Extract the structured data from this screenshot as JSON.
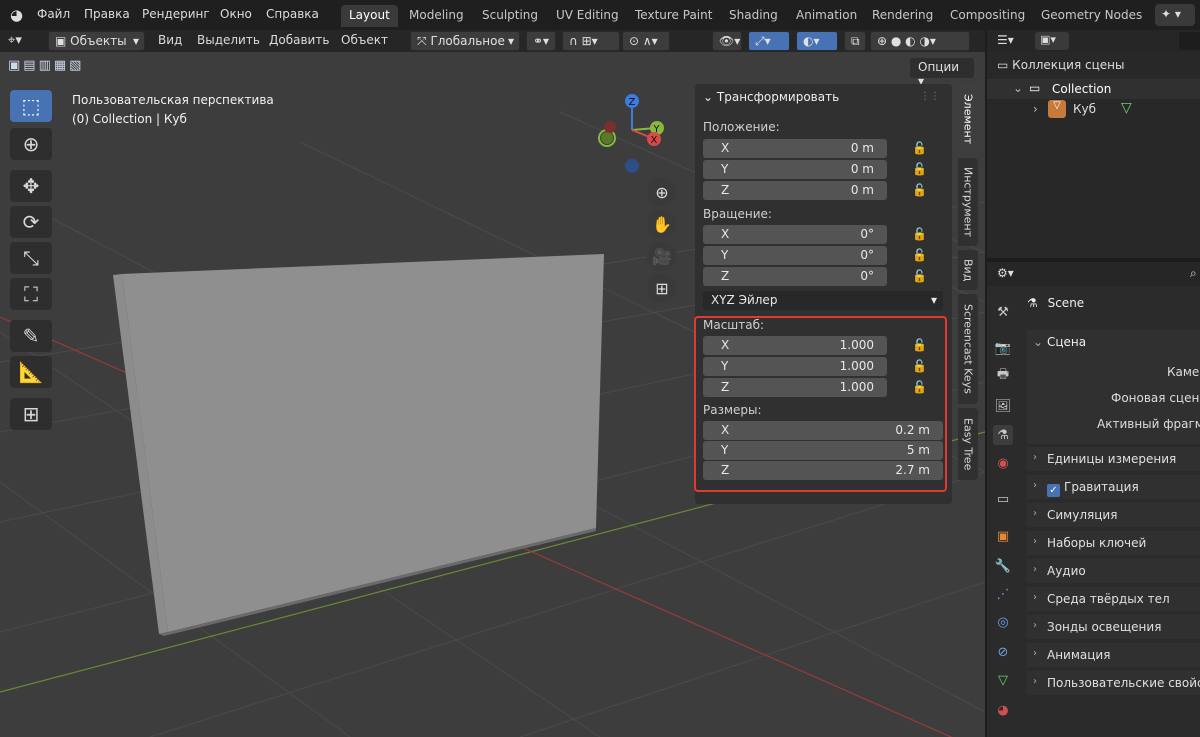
{
  "topbar": {
    "menus": [
      "Файл",
      "Правка",
      "Рендеринг",
      "Окно",
      "Справка"
    ],
    "workspaces": [
      "Layout",
      "Modeling",
      "Sculpting",
      "UV Editing",
      "Texture Paint",
      "Shading",
      "Animation",
      "Rendering",
      "Compositing",
      "Geometry Nodes"
    ],
    "active_workspace": "Layout"
  },
  "vp_header": {
    "mode": "Объекты",
    "view": "Вид",
    "select": "Выделить",
    "add": "Добавить",
    "object": "Объект",
    "orientation": "Глобальное",
    "options": "Опции"
  },
  "viewport": {
    "perspective_label": "Пользовательская перспектива",
    "collection_label": "(0) Collection | Куб",
    "gizmo": {
      "x": "X",
      "y": "Y",
      "z": "Z"
    }
  },
  "npanel": {
    "title": "Трансформировать",
    "location_label": "Положение:",
    "location": [
      {
        "axis": "X",
        "value": "0 m"
      },
      {
        "axis": "Y",
        "value": "0 m"
      },
      {
        "axis": "Z",
        "value": "0 m"
      }
    ],
    "rotation_label": "Вращение:",
    "rotation": [
      {
        "axis": "X",
        "value": "0°"
      },
      {
        "axis": "Y",
        "value": "0°"
      },
      {
        "axis": "Z",
        "value": "0°"
      }
    ],
    "rotation_mode": "XYZ Эйлер",
    "scale_label": "Масштаб:",
    "scale": [
      {
        "axis": "X",
        "value": "1.000"
      },
      {
        "axis": "Y",
        "value": "1.000"
      },
      {
        "axis": "Z",
        "value": "1.000"
      }
    ],
    "dimensions_label": "Размеры:",
    "dimensions": [
      {
        "axis": "X",
        "value": "0.2 m"
      },
      {
        "axis": "Y",
        "value": "5 m"
      },
      {
        "axis": "Z",
        "value": "2.7 m"
      }
    ],
    "highlight_color": "#e0392f"
  },
  "side_tabs": [
    "Элемент",
    "Инструмент",
    "Вид",
    "Screencast Keys",
    "Easy Tree"
  ],
  "outliner": {
    "scene_collection": "Коллекция сцены",
    "collection": "Collection",
    "object": "Куб"
  },
  "properties": {
    "scene_name": "Scene",
    "section": "Сцена",
    "fields": [
      "Камера",
      "Фоновая сцена",
      "Активный фрагмент"
    ],
    "panels": [
      "Единицы измерения",
      "Гравитация",
      "Симуляция",
      "Наборы ключей",
      "Аудио",
      "Среда твёрдых тел",
      "Зонды освещения",
      "Анимация",
      "Пользовательские свойства"
    ],
    "gravity_checked": true
  }
}
